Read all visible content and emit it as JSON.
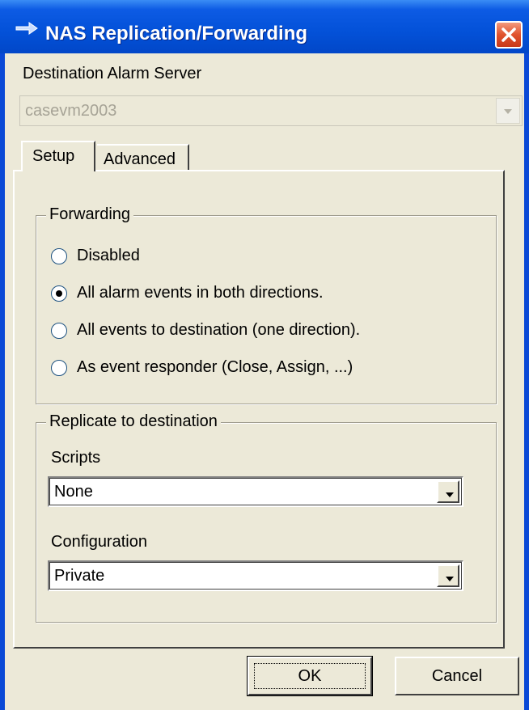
{
  "window": {
    "title": "NAS Replication/Forwarding",
    "title_icon": "arrow-right-icon",
    "close_icon": "close-icon"
  },
  "destination": {
    "label": "Destination Alarm Server",
    "value": "casevm2003",
    "enabled": false
  },
  "tabs": [
    {
      "label": "Setup",
      "selected": true
    },
    {
      "label": "Advanced",
      "selected": false
    }
  ],
  "forwarding": {
    "title": "Forwarding",
    "options": [
      {
        "label": "Disabled",
        "checked": false
      },
      {
        "label": "All alarm events in both directions.",
        "checked": true
      },
      {
        "label": "All events to destination (one direction).",
        "checked": false
      },
      {
        "label": "As event responder  (Close, Assign, ...)",
        "checked": false
      }
    ]
  },
  "replicate": {
    "title": "Replicate to destination",
    "scripts_label": "Scripts",
    "scripts_value": "None",
    "configuration_label": "Configuration",
    "configuration_value": "Private"
  },
  "buttons": {
    "ok": "OK",
    "cancel": "Cancel"
  },
  "colors": {
    "titlebar": "#0351d8",
    "dialog_face": "#ece9d8",
    "close": "#e0522d"
  }
}
